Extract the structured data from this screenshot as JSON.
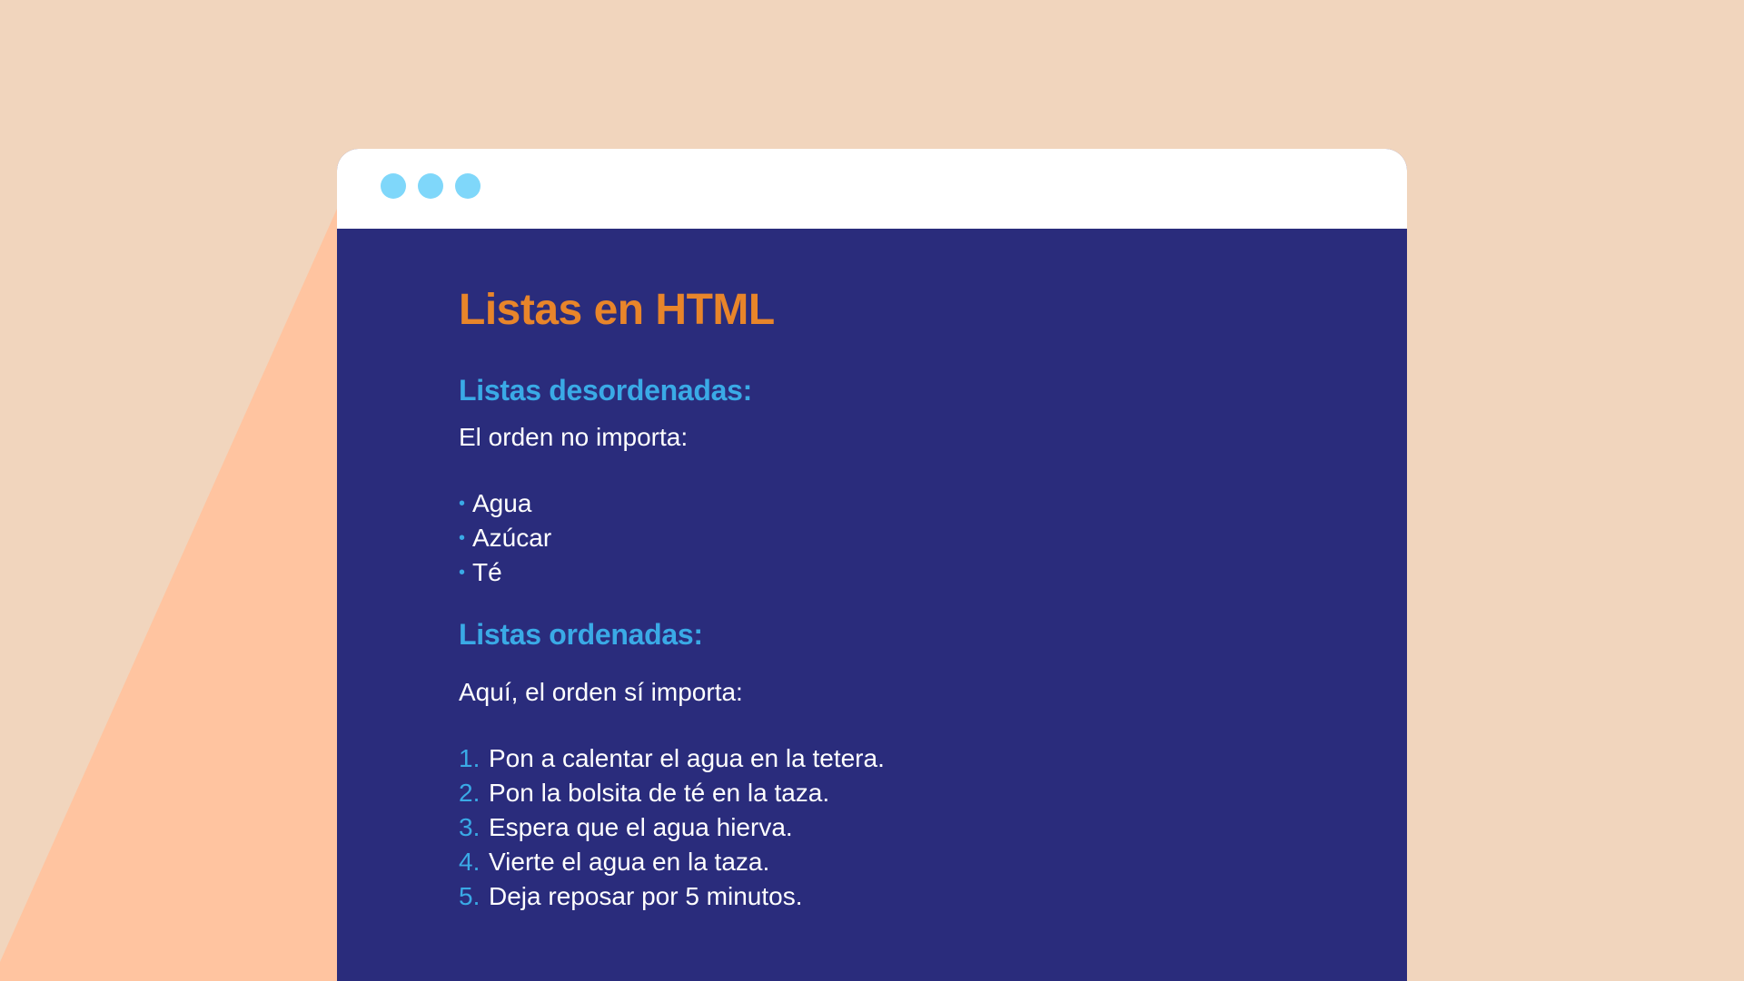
{
  "colors": {
    "background": "#F1D5BD",
    "wedge": "#FFC4A0",
    "window_body": "#2A2C7C",
    "titlebar": "#FFFFFF",
    "window_dots": "#7FD7FA",
    "title": "#E8852A",
    "heading": "#3AAAE6",
    "text": "#FFFFFF"
  },
  "page": {
    "title": "Listas en HTML"
  },
  "unordered": {
    "heading": "Listas desordenadas:",
    "intro": "El orden no importa:",
    "bullet": "•",
    "items": [
      "Agua",
      "Azúcar",
      "Té"
    ]
  },
  "ordered": {
    "heading": "Listas ordenadas:",
    "intro": "Aquí, el orden sí importa:",
    "items": [
      {
        "num": "1.",
        "text": "Pon a calentar el agua en la tetera."
      },
      {
        "num": "2.",
        "text": "Pon la bolsita de té en la taza."
      },
      {
        "num": "3.",
        "text": "Espera que el agua hierva."
      },
      {
        "num": "4.",
        "text": "Vierte el agua en la taza."
      },
      {
        "num": "5.",
        "text": "Deja reposar por 5 minutos."
      }
    ]
  }
}
